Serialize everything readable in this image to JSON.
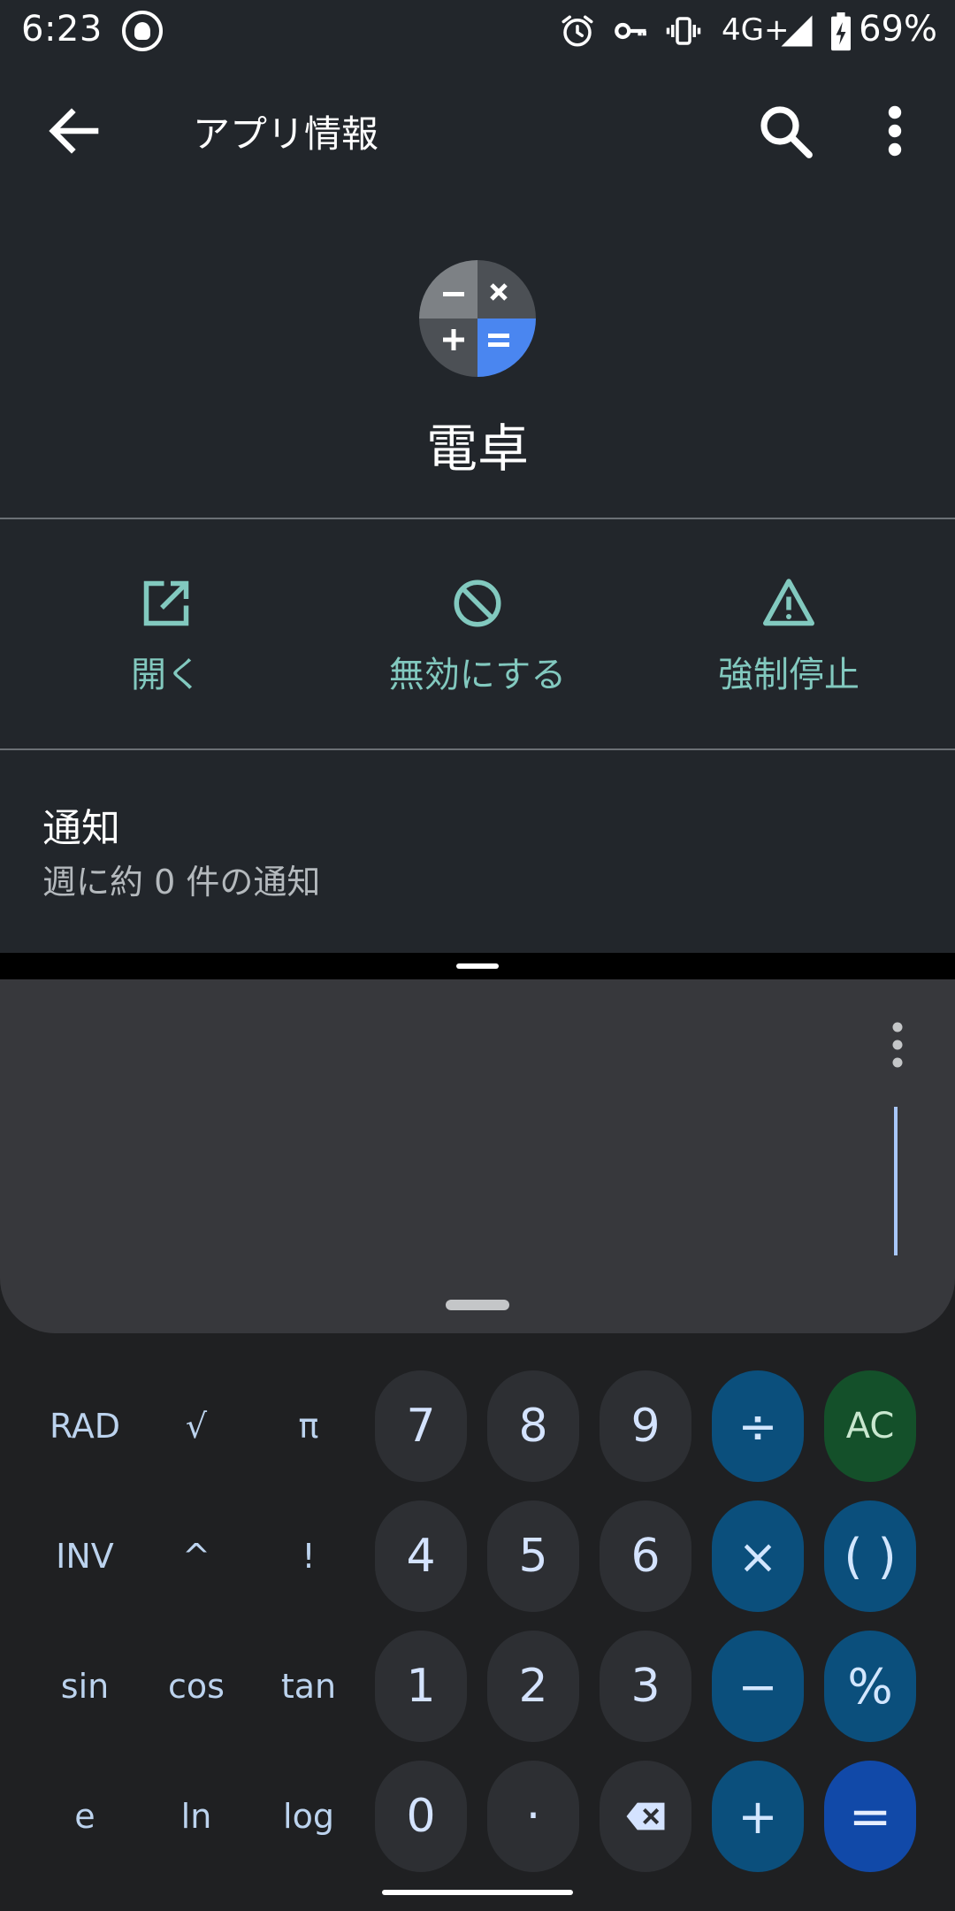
{
  "status_bar": {
    "time": "6:23",
    "network": "4G+",
    "battery_percent": "69%",
    "icons": [
      "assistant-logo-icon",
      "alarm-icon",
      "vpn-key-icon",
      "vibrate-icon",
      "signal-icon",
      "battery-charging-icon"
    ]
  },
  "toolbar": {
    "title": "アプリ情報"
  },
  "app": {
    "name": "電卓"
  },
  "actions": [
    {
      "label": "開く",
      "icon": "open-in-new-icon"
    },
    {
      "label": "無効にする",
      "icon": "block-icon"
    },
    {
      "label": "強制停止",
      "icon": "warning-icon"
    }
  ],
  "notifications": {
    "title": "通知",
    "summary": "週に約 0 件の通知"
  },
  "calculator": {
    "rows": [
      [
        "RAD",
        "√",
        "π",
        "7",
        "8",
        "9",
        "÷",
        "AC"
      ],
      [
        "INV",
        "^",
        "!",
        "4",
        "5",
        "6",
        "×",
        "( )"
      ],
      [
        "sin",
        "cos",
        "tan",
        "1",
        "2",
        "3",
        "−",
        "%"
      ],
      [
        "e",
        "ln",
        "log",
        "0",
        "·",
        "⌫",
        "+",
        "="
      ]
    ]
  },
  "colors": {
    "accent_teal": "#82c9bf",
    "operator_blue": "#0b4f7c",
    "ac_green": "#14502a",
    "equals_blue": "#1149a8"
  }
}
